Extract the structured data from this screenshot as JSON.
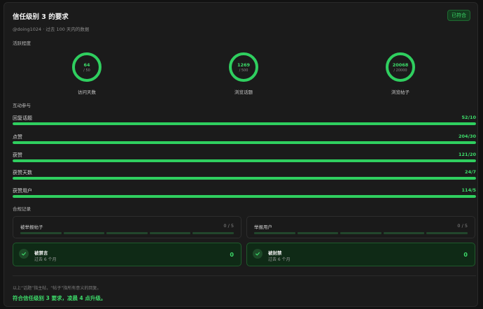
{
  "header": {
    "title": "信任级别 3 的要求",
    "badge": "已符合",
    "subtitle": "@doing1024 · 过去 100 天内的数据"
  },
  "activity": {
    "section_title": "活跃程度",
    "rings": [
      {
        "value": "64",
        "max": "/ 50",
        "label": "访问天数",
        "progress": 1.0
      },
      {
        "value": "1269",
        "max": "/ 500",
        "label": "浏览话题",
        "progress": 1.0
      },
      {
        "value": "20068",
        "max": "/ 20000",
        "label": "浏览帖子",
        "progress": 1.0
      }
    ]
  },
  "interaction": {
    "section_title": "互动参与",
    "rows": [
      {
        "label": "回复话题",
        "value": "52/10",
        "progress": 1.0
      },
      {
        "label": "点赞",
        "value": "204/30",
        "progress": 1.0
      },
      {
        "label": "获赞",
        "value": "121/20",
        "progress": 1.0
      },
      {
        "label": "获赞天数",
        "value": "24/7",
        "progress": 1.0
      },
      {
        "label": "获赞用户",
        "value": "114/5",
        "progress": 1.0
      }
    ]
  },
  "compliance": {
    "section_title": "合规记录",
    "reported_posts": {
      "label": "被举报帖子",
      "count": "0 / 5"
    },
    "reporting_users": {
      "label": "举报用户",
      "count": "0 / 5"
    },
    "silenced": {
      "title": "被禁言",
      "sub": "过去 6 个月",
      "value": "0"
    },
    "suspended": {
      "title": "被封禁",
      "sub": "过去 6 个月",
      "value": "0"
    }
  },
  "footer": {
    "note": "以上“话题”指主帖，“帖子”指所有意义的回复。",
    "summary": "符合信任级别 3 要求，凌晨 4 点升级。"
  },
  "colors": {
    "accent": "#2fcf5f",
    "accent_text": "#3ddc6a",
    "background": "#1b1b1b"
  }
}
